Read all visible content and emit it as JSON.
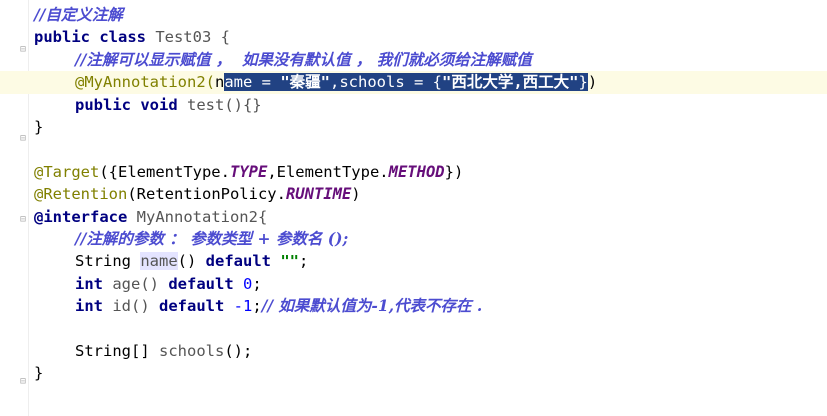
{
  "code": {
    "l1": "//自定义注解",
    "l2_kw": "public class",
    "l2_name": " Test03 {",
    "l3": "//注解可以显示赋值 ，  如果没有默认值 ， 我们就必须给注解赋值",
    "l4_ann": "@MyAnnotation2(",
    "l4_pre": "n",
    "l4_sel_a": "ame = ",
    "l4_sel_s1": "\"秦疆\"",
    "l4_sel_b": ",schools = {",
    "l4_sel_s2": "\"西北大学,西工大\"",
    "l4_sel_c": "}",
    "l4_post": ")",
    "l5_kw": "public void",
    "l5_rest": " test(){}",
    "l6": "}",
    "l7_ann": "@Target",
    "l7_a": "({ElementType.",
    "l7_c1": "TYPE",
    "l7_b": ",ElementType.",
    "l7_c2": "METHOD",
    "l7_end": "})",
    "l8_ann": "@Retention",
    "l8_a": "(RetentionPolicy.",
    "l8_c": "RUNTIME",
    "l8_end": ")",
    "l9_kw": "@interface",
    "l9_rest": " MyAnnotation2{",
    "l10": "//注解的参数 ： 参数类型 + 参数名 ();",
    "l11_a": "String ",
    "l11_name": "name",
    "l11_b": "() ",
    "l11_kw": "default",
    "l11_str": " \"\"",
    "l11_end": ";",
    "l12_kw": "int",
    "l12_a": " age() ",
    "l12_kw2": "default",
    "l12_num": " 0",
    "l12_end": ";",
    "l13_kw": "int",
    "l13_a": " id() ",
    "l13_kw2": "default",
    "l13_num": " -1",
    "l13_end": ";",
    "l13_cm": "// 如果默认值为-1,代表不存在 .",
    "l15_a": "String[] ",
    "l15_b": "schools",
    "l15_c": "();",
    "l16": "}"
  },
  "colors": {
    "keyword": "#000080",
    "comment": "#5f5fcf",
    "annotation": "#808000",
    "string": "#008000",
    "number": "#0000ff",
    "constant": "#660e7a",
    "selection": "#214283",
    "current_line": "#fdfbe4"
  }
}
